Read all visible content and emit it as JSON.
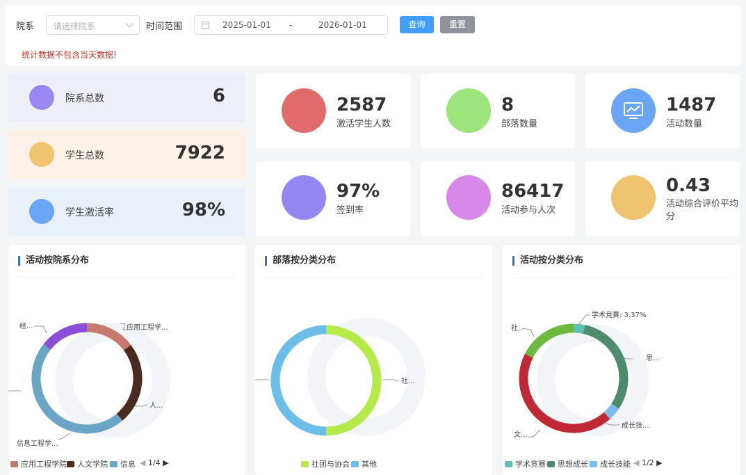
{
  "filter": {
    "dept_label": "院系",
    "dept_placeholder": "请选择院系",
    "time_label": "时间范围",
    "start_date": "2025-01-01",
    "range_sep": "-",
    "end_date": "2026-01-01",
    "query_label": "查询",
    "reset_label": "重置",
    "warning": "统计数据不包含当天数据!"
  },
  "left_stats": [
    {
      "label": "院系总数",
      "value": "6",
      "color": "#9b87f0",
      "bg": "#eeeef7"
    },
    {
      "label": "学生总数",
      "value": "7922",
      "color": "#f0c36e",
      "bg": "#fbf1e6"
    },
    {
      "label": "学生激活率",
      "value": "98%",
      "color": "#6aa6f5",
      "bg": "#e8f0fa"
    }
  ],
  "right_stats": [
    {
      "value": "2587",
      "label": "激活学生人数",
      "color": "#e06b6b"
    },
    {
      "value": "8",
      "label": "部落数量",
      "color": "#9ce57a"
    },
    {
      "value": "1487",
      "label": "活动数量",
      "color": "#6aa6f5",
      "icon": "chart-monitor-icon"
    },
    {
      "value": "97%",
      "label": "签到率",
      "color": "#9487f2"
    },
    {
      "value": "86417",
      "label": "活动参与人次",
      "color": "#d687e8"
    },
    {
      "value": "0.43",
      "label": "活动综合评价平均分",
      "color": "#f0c36e"
    }
  ],
  "charts": {
    "c1": {
      "title": "活动按院系分布",
      "labels": {
        "a": "应用工程学...",
        "b": "人...",
        "c": "信息工程学...",
        "d": "经..."
      },
      "legend": [
        "应用工程学院",
        "人文学院",
        "信息"
      ],
      "page": "1/4"
    },
    "c2": {
      "title": "部落按分类分布",
      "labels": {
        "a": "社..."
      },
      "legend": [
        "社团与协会",
        "其他"
      ]
    },
    "c3": {
      "title": "活动按分类分布",
      "labels": {
        "a": "学术竞赛: 3.37%",
        "b": "思...",
        "c": "成长技...",
        "d": "文...",
        "e": "社..."
      },
      "legend": [
        "学术竞赛",
        "思想成长",
        "成长技能"
      ],
      "page": "1/2"
    }
  },
  "chart_data": [
    {
      "type": "pie",
      "title": "活动按院系分布",
      "categories": [
        "应用工程学院",
        "人文学院",
        "信息工程学院",
        "经..."
      ],
      "values": [
        13.6,
        22.5,
        43.4,
        13.4
      ],
      "colors": [
        "#c8796f",
        "#4a2b20",
        "#6ba5c5",
        "#8a4fd6"
      ]
    },
    {
      "type": "pie",
      "title": "部落按分类分布",
      "categories": [
        "社团与协会",
        "其他"
      ],
      "values": [
        50,
        50
      ],
      "colors": [
        "#b5ea4a",
        "#6cbde8"
      ]
    },
    {
      "type": "pie",
      "title": "活动按分类分布",
      "categories": [
        "学术竞赛",
        "思想成长",
        "成长技能",
        "文...",
        "社..."
      ],
      "values": [
        3.37,
        31,
        4,
        44,
        17.6
      ],
      "colors": [
        "#5fbfb0",
        "#4e8a6c",
        "#7dbbe8",
        "#c02835",
        "#6db83f"
      ]
    }
  ]
}
